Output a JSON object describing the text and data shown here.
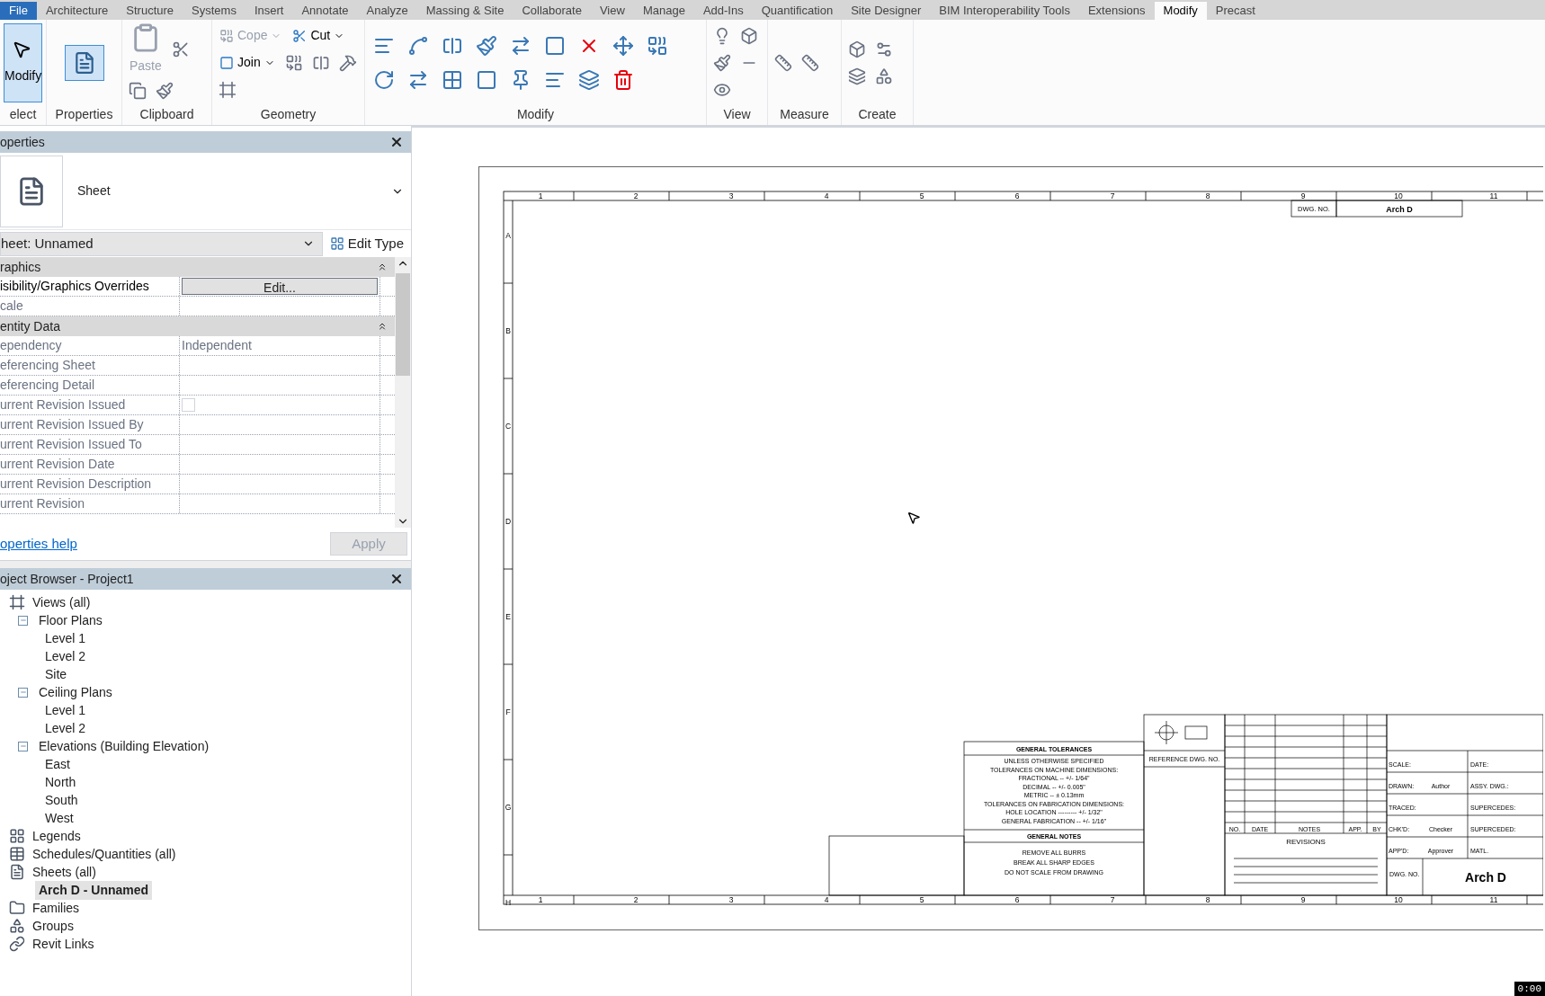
{
  "ribbon_tabs": [
    {
      "label": "File",
      "kind": "file",
      "selected": false
    },
    {
      "label": "Architecture",
      "kind": "tab",
      "selected": false
    },
    {
      "label": "Structure",
      "kind": "tab",
      "selected": false
    },
    {
      "label": "Systems",
      "kind": "tab",
      "selected": false
    },
    {
      "label": "Insert",
      "kind": "tab",
      "selected": false
    },
    {
      "label": "Annotate",
      "kind": "tab",
      "selected": false
    },
    {
      "label": "Analyze",
      "kind": "tab",
      "selected": false
    },
    {
      "label": "Massing & Site",
      "kind": "tab",
      "selected": false
    },
    {
      "label": "Collaborate",
      "kind": "tab",
      "selected": false
    },
    {
      "label": "View",
      "kind": "tab",
      "selected": false
    },
    {
      "label": "Manage",
      "kind": "tab",
      "selected": false
    },
    {
      "label": "Add-Ins",
      "kind": "tab",
      "selected": false
    },
    {
      "label": "Quantification",
      "kind": "tab",
      "selected": false
    },
    {
      "label": "Site Designer",
      "kind": "tab",
      "selected": false
    },
    {
      "label": "BIM Interoperability Tools",
      "kind": "tab",
      "selected": false
    },
    {
      "label": "Extensions",
      "kind": "tab",
      "selected": false
    },
    {
      "label": "Modify",
      "kind": "tab",
      "selected": true
    },
    {
      "label": "Precast",
      "kind": "tab",
      "selected": false
    }
  ],
  "ribbon_panels": [
    {
      "label": "elect",
      "buttons": [
        {
          "label": "Modify",
          "selected": true,
          "disabled": false
        }
      ]
    },
    {
      "label": "Properties"
    },
    {
      "label": "Clipboard",
      "buttons": [
        {
          "label": "Paste",
          "selected": false,
          "disabled": true
        }
      ]
    },
    {
      "label": "Geometry",
      "buttons": [
        {
          "label": "Cope",
          "selected": false,
          "disabled": true
        },
        {
          "label": "Cut",
          "selected": false,
          "disabled": false
        },
        {
          "label": "Join",
          "selected": false,
          "disabled": false
        }
      ]
    },
    {
      "label": "Modify"
    },
    {
      "label": "View"
    },
    {
      "label": "Measure"
    },
    {
      "label": "Create"
    }
  ],
  "properties": {
    "title": "operties",
    "type_name": "Sheet",
    "type_selector": "heet: Unnamed",
    "edit_type": "Edit Type",
    "rows": [
      {
        "kind": "section",
        "label": "raphics"
      },
      {
        "kind": "button",
        "label": "isibility/Graphics Overrides",
        "value": "Edit..."
      },
      {
        "kind": "field",
        "label": "cale"
      },
      {
        "kind": "section",
        "label": "entity Data"
      },
      {
        "kind": "field",
        "label": "ependency",
        "value": "Independent"
      },
      {
        "kind": "field",
        "label": "eferencing Sheet"
      },
      {
        "kind": "field",
        "label": "eferencing Detail"
      },
      {
        "kind": "checkbox",
        "label": "urrent Revision Issued",
        "checked": false
      },
      {
        "kind": "field",
        "label": "urrent Revision Issued By"
      },
      {
        "kind": "field",
        "label": "urrent Revision Issued To"
      },
      {
        "kind": "field",
        "label": "urrent Revision Date"
      },
      {
        "kind": "field",
        "label": "urrent Revision Description"
      },
      {
        "kind": "field",
        "label": "urrent Revision"
      }
    ],
    "help_link": "operties help",
    "apply": "Apply",
    "apply_disabled": true
  },
  "project_browser": {
    "title": "oject Browser - Project1",
    "tree": [
      {
        "label": "Views (all)",
        "kind": "views",
        "expanded": true,
        "selected": false,
        "children": [
          {
            "label": "Floor Plans",
            "expanded": true,
            "selected": false,
            "children": [
              {
                "label": "Level 1",
                "selected": false
              },
              {
                "label": "Level 2",
                "selected": false
              },
              {
                "label": "Site",
                "selected": false
              }
            ]
          },
          {
            "label": "Ceiling Plans",
            "expanded": true,
            "selected": false,
            "children": [
              {
                "label": "Level 1",
                "selected": false
              },
              {
                "label": "Level 2",
                "selected": false
              }
            ]
          },
          {
            "label": "Elevations (Building Elevation)",
            "expanded": true,
            "selected": false,
            "children": [
              {
                "label": "East",
                "selected": false
              },
              {
                "label": "North",
                "selected": false
              },
              {
                "label": "South",
                "selected": false
              },
              {
                "label": "West",
                "selected": false
              }
            ]
          }
        ]
      },
      {
        "label": "Legends",
        "kind": "legend",
        "selected": false
      },
      {
        "label": "Schedules/Quantities (all)",
        "kind": "schedule",
        "selected": false
      },
      {
        "label": "Sheets (all)",
        "kind": "sheet",
        "expanded": true,
        "selected": false,
        "children": [
          {
            "label": "Arch D - Unnamed",
            "selected": true
          }
        ]
      },
      {
        "label": "Families",
        "kind": "family",
        "selected": false
      },
      {
        "label": "Groups",
        "kind": "group",
        "selected": false
      },
      {
        "label": "Revit Links",
        "kind": "link",
        "selected": false
      }
    ]
  },
  "sheet": {
    "top_columns": [
      "1",
      "2",
      "3",
      "4",
      "5",
      "6",
      "7",
      "8",
      "9",
      "10",
      "11"
    ],
    "bottom_columns": [
      "1",
      "2",
      "3",
      "4",
      "5",
      "6",
      "7",
      "8",
      "9",
      "10",
      "11"
    ],
    "rows": [
      "A",
      "B",
      "C",
      "D",
      "E",
      "F",
      "G",
      "H"
    ],
    "top_dwg_label": "DWG. NO.",
    "top_dwg_no": "Arch D",
    "tolerances": [
      "GENERAL TOLERANCES",
      "UNLESS OTHERWISE SPECIFIED",
      "TOLERANCES ON MACHINE DIMENSIONS:",
      "FRACTIONAL -- +/- 1/64\"",
      "DECIMAL -- +/- 0.005\"",
      "METRIC -- ± 0.13mm",
      "TOLERANCES ON FABRICATION DIMENSIONS:",
      "HOLE LOCATION --------- +/- 1/32\"",
      "GENERAL FABRICATION -- +/- 1/16\""
    ],
    "notes": [
      "GENERAL NOTES",
      "REMOVE ALL BURRS",
      "BREAK ALL SHARP EDGES",
      "DO NOT SCALE FROM DRAWING"
    ],
    "reference": "REFERENCE DWG. NO.",
    "revision_columns": [
      "NO.",
      "DATE",
      "NOTES",
      "APP.",
      "BY"
    ],
    "revisions_title": "REVISIONS",
    "left_fields": [
      {
        "label": "SCALE:"
      },
      {
        "label": "DRAWN:",
        "value": "Author"
      },
      {
        "label": "TRACED:"
      },
      {
        "label": "CHK'D:",
        "value": "Checker"
      },
      {
        "label": "APP'D:",
        "value": "Approver"
      }
    ],
    "right_fields": [
      "DATE:",
      "ASSY. DWG.:",
      "SUPERCEDES:",
      "SUPERCEDED:",
      "MATL."
    ],
    "dwg_label": "DWG. NO.",
    "dwg_no": "Arch D"
  },
  "timer": "0:00"
}
